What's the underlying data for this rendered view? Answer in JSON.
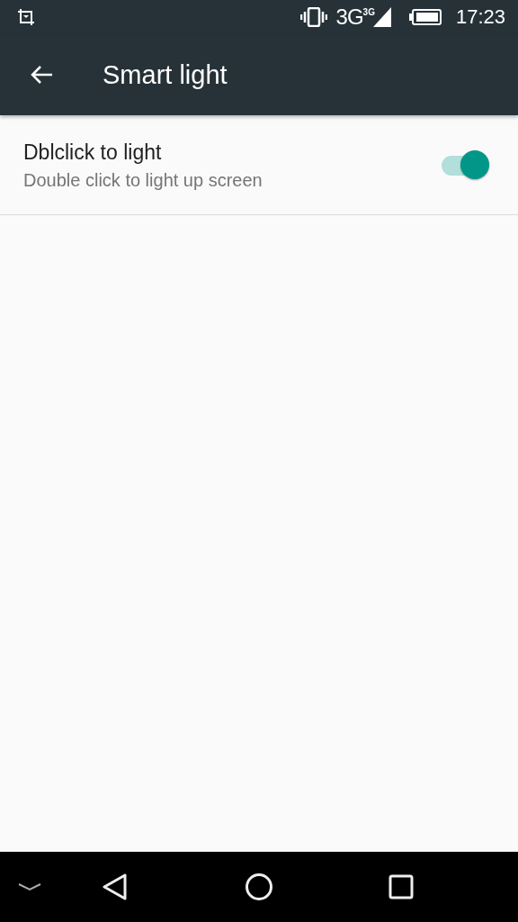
{
  "status_bar": {
    "network": "3G",
    "network_small": "3G",
    "time": "17:23"
  },
  "app_bar": {
    "title": "Smart light"
  },
  "settings": [
    {
      "title": "Dblclick to light",
      "summary": "Double click to light up screen",
      "on": true
    }
  ]
}
